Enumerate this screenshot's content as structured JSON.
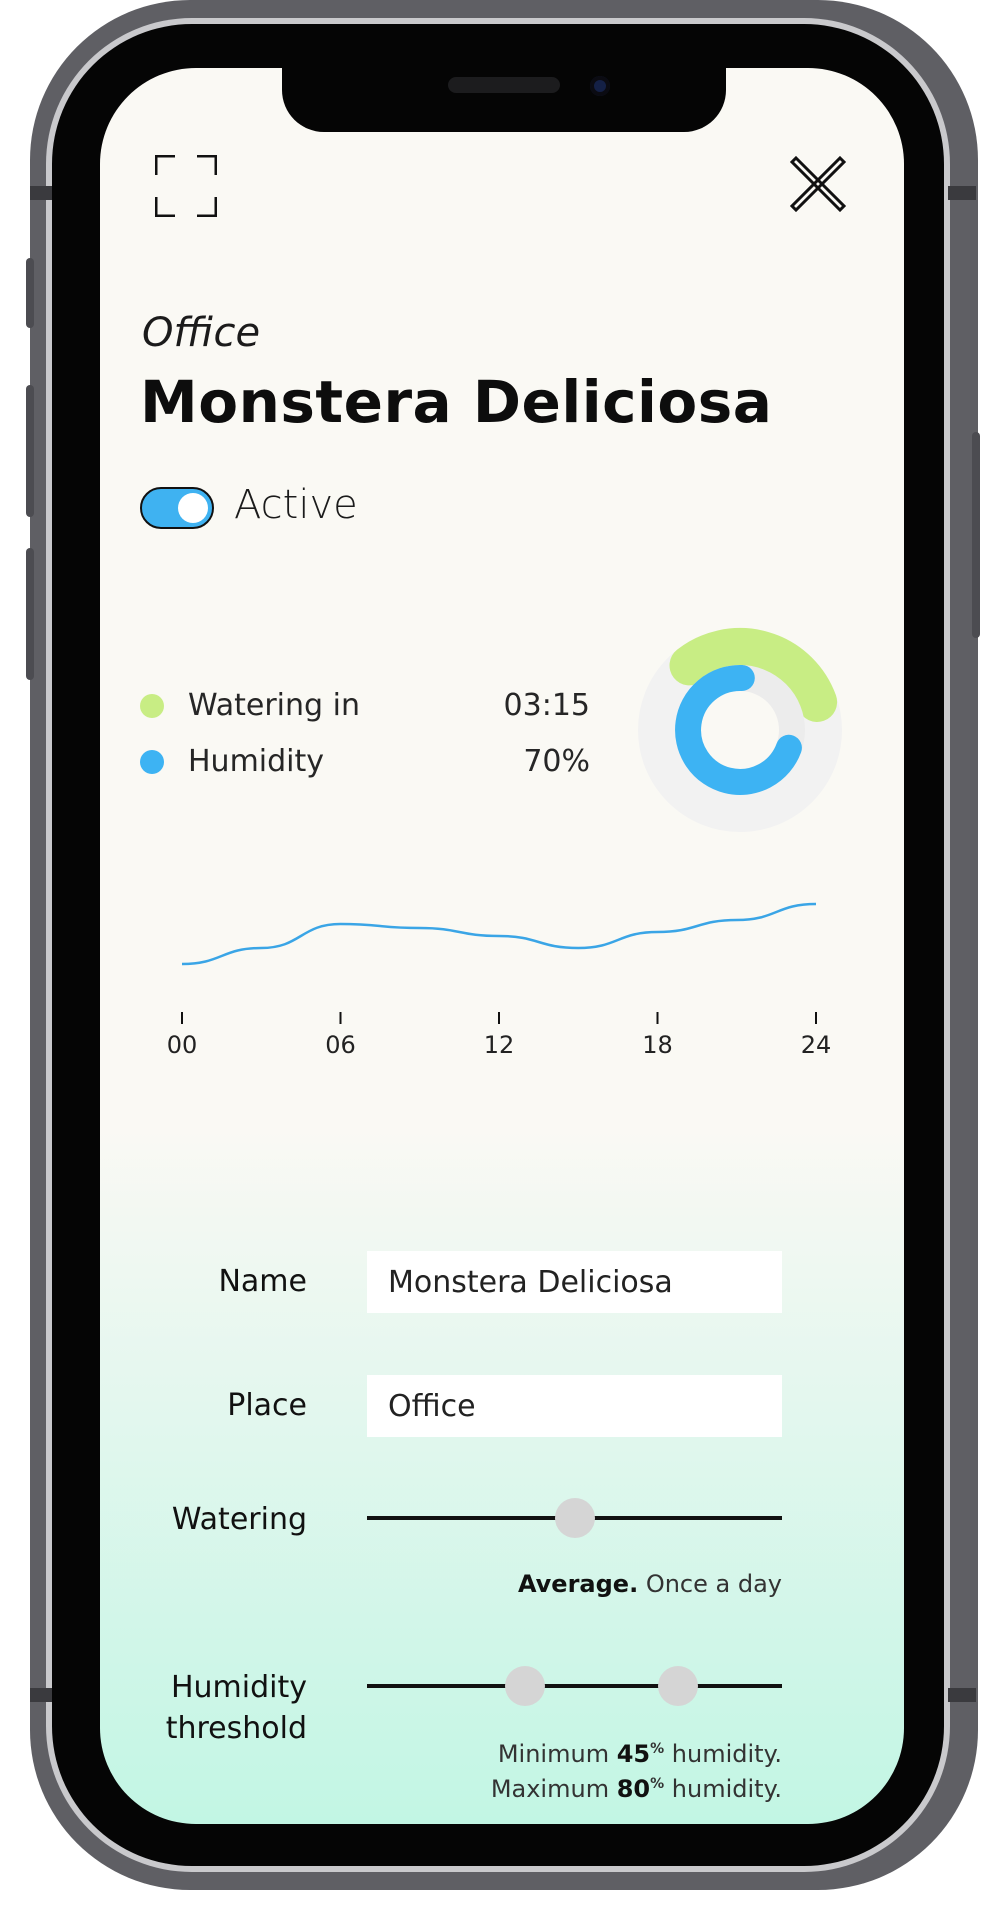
{
  "header": {
    "place": "Office",
    "title": "Monstera Deliciosa"
  },
  "status": {
    "active": true,
    "label": "Active",
    "toggle_color": "#3fb2f1"
  },
  "stats": {
    "watering_label": "Watering in",
    "watering_value": "03:15",
    "watering_color": "#c8ed84",
    "humidity_label": "Humidity",
    "humidity_value": "70%",
    "humidity_color": "#3db3f3"
  },
  "chart_data": [
    {
      "type": "pie",
      "style": "concentric-rings",
      "series": [
        {
          "name": "Watering in",
          "fraction": 0.3,
          "color": "#c8ed84"
        },
        {
          "name": "Humidity",
          "fraction": 0.7,
          "color": "#3db3f3"
        }
      ],
      "background_ring_color": "#f2f2f2"
    },
    {
      "type": "line",
      "x": [
        0,
        3,
        6,
        9,
        12,
        15,
        18,
        21,
        24
      ],
      "y": [
        0.2,
        0.4,
        0.7,
        0.65,
        0.55,
        0.4,
        0.6,
        0.75,
        0.95
      ],
      "xticks": [
        "00",
        "06",
        "12",
        "18",
        "24"
      ],
      "xlim": [
        0,
        24
      ],
      "ylim": [
        0,
        1
      ],
      "line_color": "#3aa5e6",
      "grid": false
    }
  ],
  "form": {
    "name_label": "Name",
    "name_value": "Monstera Deliciosa",
    "place_label": "Place",
    "place_value": "Office",
    "watering_label": "Watering",
    "watering_level": 0.5,
    "watering_caption_bold": "Average.",
    "watering_caption_rest": "Once a day",
    "humidity_label_line1": "Humidity",
    "humidity_label_line2": "threshold",
    "humidity_min_pct": 0.38,
    "humidity_max_pct": 0.75,
    "min_prefix": "Minimum",
    "min_value": "45",
    "max_prefix": "Maximum",
    "max_value": "80",
    "percent_sup": "%",
    "humidity_suffix": "humidity."
  },
  "icons": {
    "expand": "expand-icon",
    "close": "close-icon"
  }
}
